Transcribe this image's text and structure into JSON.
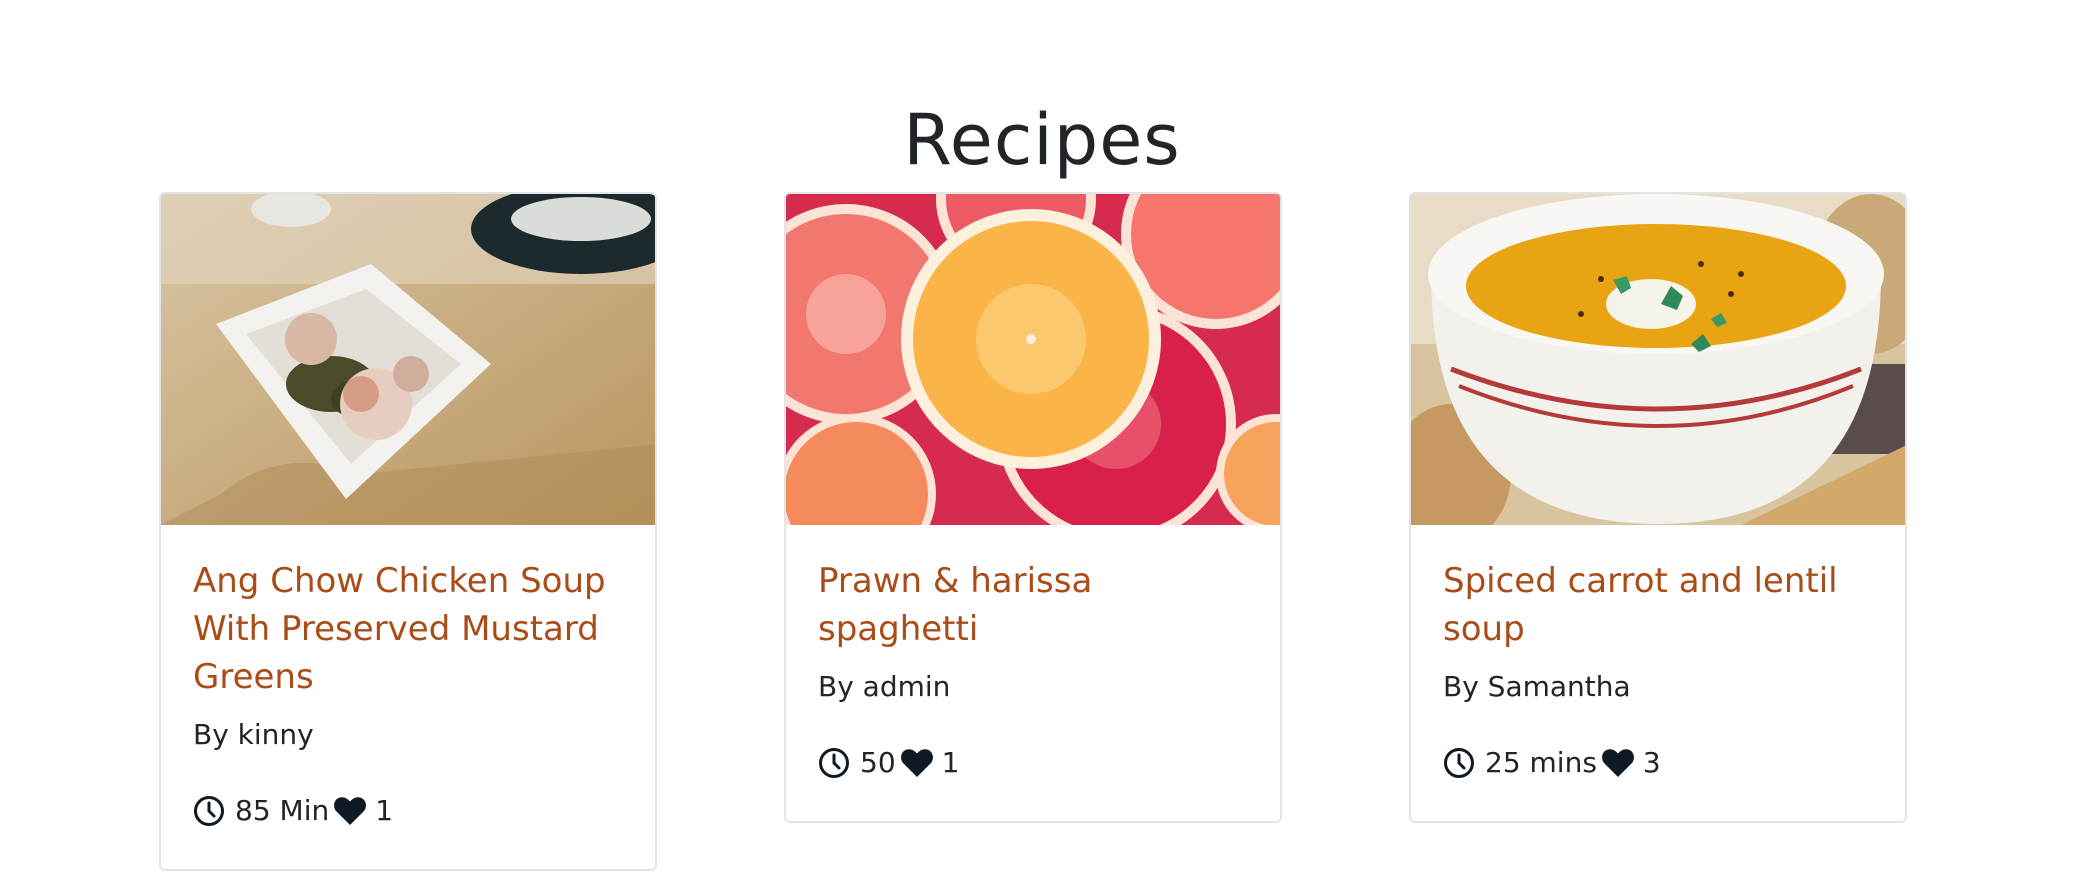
{
  "page": {
    "title": "Recipes"
  },
  "recipes": [
    {
      "title": "Ang Chow Chicken Soup With Preserved Mustard Greens",
      "author": "By kinny",
      "time": "85 Min",
      "likes": "1",
      "image_icon": "chicken-soup-image"
    },
    {
      "title": "Prawn & harissa spaghetti",
      "author": "By admin",
      "time": "50",
      "likes": "1",
      "image_icon": "citrus-slices-image"
    },
    {
      "title": "Spiced carrot and lentil soup",
      "author": "By Samantha",
      "time": "25 mins",
      "likes": "3",
      "image_icon": "carrot-soup-image"
    }
  ],
  "colors": {
    "title_link": "#a94c17",
    "icon": "#0f1a24",
    "border": "#e2e4e7"
  }
}
